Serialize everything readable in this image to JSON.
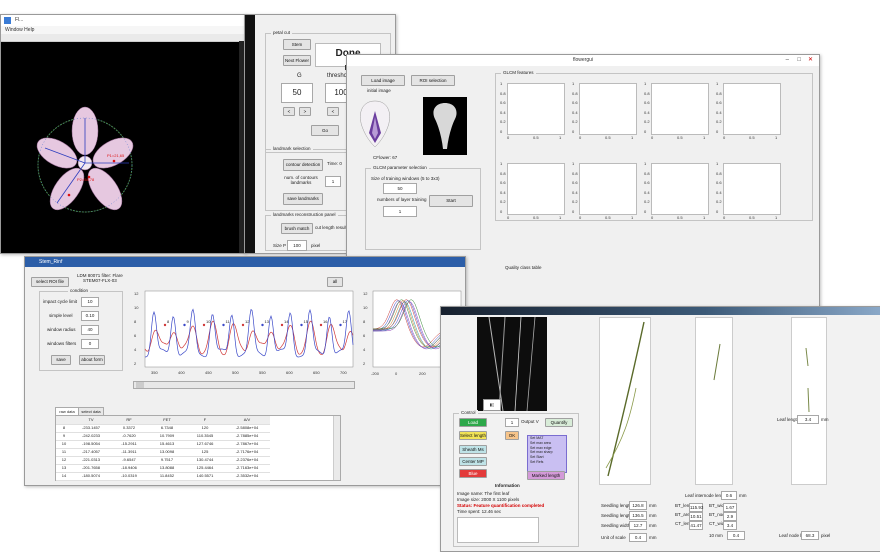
{
  "w1": {
    "title": "Fl...",
    "menu": "Window  Help"
  },
  "w2": {
    "panel1": "petal cut",
    "btns": [
      "Stem",
      "Next Flower",
      "Go"
    ],
    "done": "Done",
    "g": "G",
    "threshold": "threshold",
    "gval": "50",
    "tval": "100",
    "panel2": "landmark selection",
    "contour_btn": "contour detection",
    "time": "Time: 0",
    "num_label": "num. of contours landmarks",
    "num_val": "1",
    "save_btn": "save landmarks",
    "panel3": "landmarks reconstruction panel",
    "match_btn": "brush match",
    "cut_len": "cut length result",
    "size_label": "Size P",
    "size_val": "100",
    "pixel": "pixel"
  },
  "w3": {
    "title": "flowergui",
    "load_btn": "Load image",
    "roi_btn": "ROI selection",
    "init": "initial image",
    "cflower": "CFlower: 67",
    "sel_panel": "GLCM parameter selection",
    "sz_label": "Size of training windows (5 to 3x3)",
    "sz_val": "50",
    "num_label": "numbers of layer training",
    "num_val": "1",
    "start": "Start",
    "features": "GLCM features",
    "quality": "Quality class table",
    "yt": [
      "1",
      "0.8",
      "0.6",
      "0.4",
      "0.2",
      "0"
    ],
    "xt": [
      "0",
      "0.5",
      "1"
    ]
  },
  "w4": {
    "title": "Stem_Rinf",
    "select": "select ROI file",
    "info": "LDM 80071 filter: Flare\nSTEM07-FLX-03",
    "ctrl": "condition",
    "f1": "impact cycle limit",
    "v1": "10",
    "f2": "simple level",
    "v2": "0.10",
    "f3": "window radius",
    "v3": "40",
    "f4": "windows filters",
    "v4": "0",
    "save": "save",
    "about": "about form",
    "xl": "all",
    "axis_x": [
      "350",
      "400",
      "450",
      "500",
      "550",
      "600",
      "650",
      "700"
    ],
    "axis_y": [
      "12",
      "10",
      "8",
      "6",
      "4",
      "2"
    ],
    "axis2_x": [
      "-200",
      "0",
      "200",
      "400"
    ],
    "peaks": [
      "8",
      "9",
      "10",
      "11",
      "12",
      "13",
      "14",
      "15",
      "16",
      "17"
    ],
    "tabs": [
      "raw data",
      "select data"
    ],
    "cols": [
      "",
      "TV",
      "RF",
      "FET",
      "F",
      "A/V"
    ],
    "rows": [
      [
        "8",
        "-233.1457",
        "0.3372",
        "6.7348",
        "120",
        "-2.5808e+04"
      ],
      [
        "9",
        "-242.0233",
        "-0.7620",
        "10.7909",
        "110.3545",
        "-2.7885e+04"
      ],
      [
        "10",
        "-198.5054",
        "-15.2911",
        "15.4613",
        "127.6746",
        "-2.7867e+04"
      ],
      [
        "11",
        "-217.4057",
        "-11.3911",
        "13.0098",
        "125",
        "-2.7176e+04"
      ],
      [
        "12",
        "-221.0313",
        "-9.6547",
        "9.7517",
        "130.4744",
        "-2.2376e+04"
      ],
      [
        "13",
        "-201.7658",
        "-18.9406",
        "13.8088",
        "125.4464",
        "-2.7163e+04"
      ],
      [
        "14",
        "-180.5074",
        "-10.0319",
        "11.8452",
        "140.5571",
        "-2.3532e+04"
      ]
    ]
  },
  "w5": {
    "sec": "Control",
    "cycle_btn": "Load",
    "d_label": "Output V",
    "quantify": "Quantify",
    "sel_len": "Select length",
    "list": [
      "Set MAT",
      "Set max area",
      "Set max edge",
      "Set max sharp",
      "Set Start",
      "Set Refs"
    ],
    "b3": "Sheath Ms",
    "b4": "Center MP",
    "b5": "Blue",
    "b_ok": "OK",
    "marked": "Marked length",
    "info_title": "Information",
    "i1": "Image name: The first leaf",
    "i2": "Image size: 2000 X 1100 pixels",
    "status": "Status: Feature quantification completed",
    "time": "Time spent: 12.46 sec",
    "m1": "Seedling length",
    "m2": "Seedling length",
    "m3": "Seedling width",
    "m4": "Unit of scale",
    "v1": "126.8",
    "v2": "136.5",
    "v3": "12.7",
    "v4": "0.4",
    "u": "mm",
    "ul": "10 mm",
    "r1": [
      "BT_length",
      "115.93",
      "BT_width",
      "1.67"
    ],
    "r2": [
      "BT_area",
      "10.51",
      "BT_node",
      "2.9"
    ],
    "r3": [
      "CT_length",
      "41.47",
      "CT_width",
      "3.4"
    ],
    "mid_len": "Leaf internode length",
    "mid_val": "0.6",
    "right_len": "Leaf node length",
    "right_val": "68.3",
    "pixel": "pixel",
    "scale": "Leaf length",
    "scale_val": "3.4"
  }
}
